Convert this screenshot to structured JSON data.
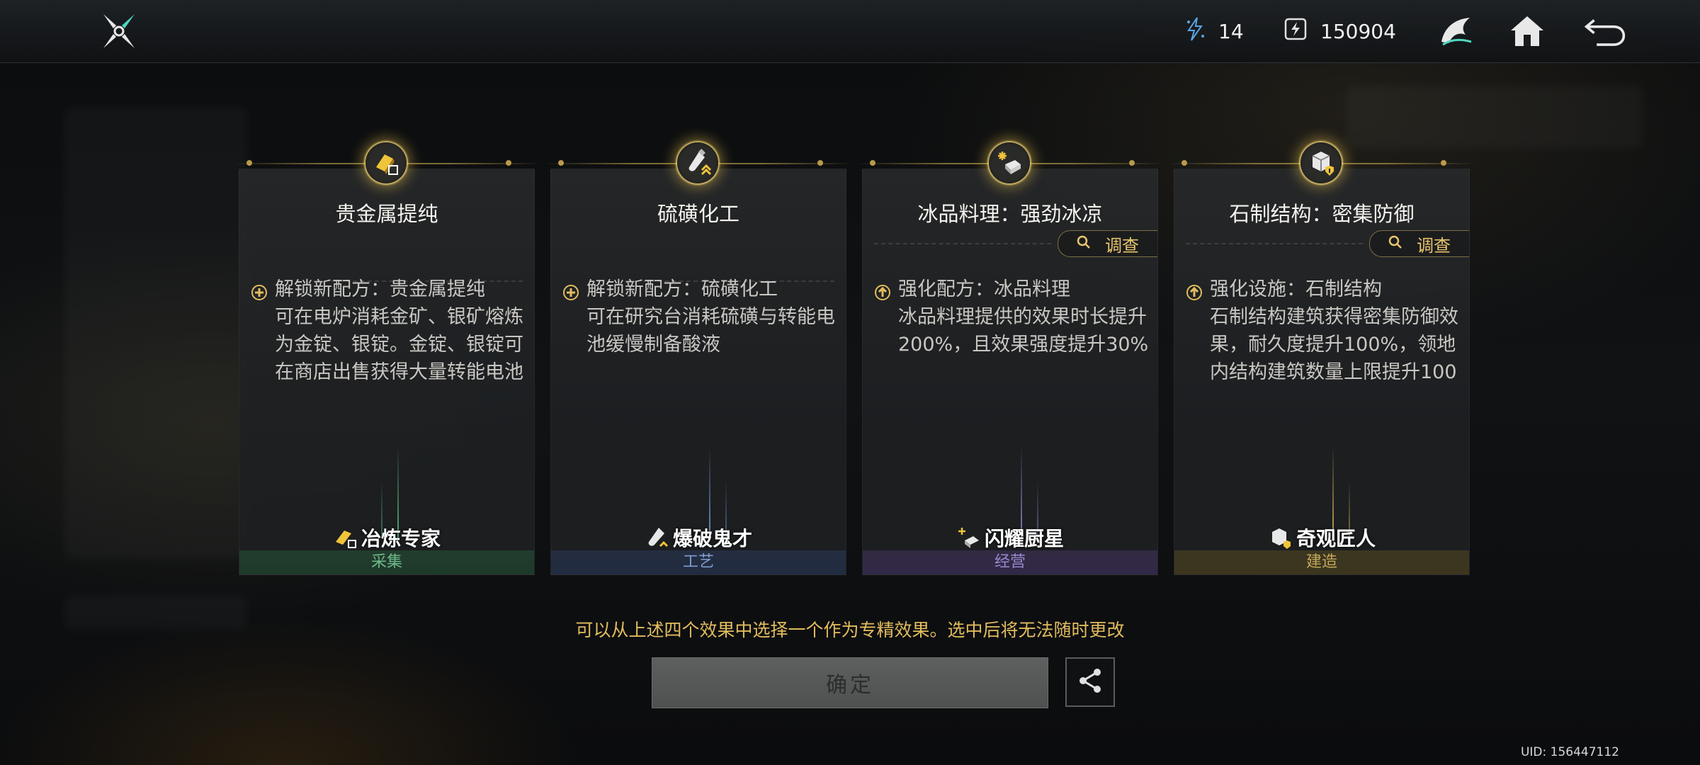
{
  "header": {
    "resource1_value": "14",
    "resource2_value": "150904",
    "icons": [
      "logo-icon",
      "energy-icon",
      "currency-icon",
      "emblem-icon",
      "home-icon",
      "back-icon"
    ]
  },
  "cards": [
    {
      "title": "贵金属提纯",
      "desc_head": "解锁新配方：贵金属提纯",
      "desc_body": "可在电炉消耗金矿、银矿熔炼为金锭、银锭。金锭、银锭可在商店出售获得大量转能电池",
      "desc_icon": "plus-circle-icon",
      "specialist": "冶炼专家",
      "category": "采集",
      "category_color": "#3f8a5c",
      "beam_color": "#5fcf8f"
    },
    {
      "title": "硫磺化工",
      "desc_head": "解锁新配方：硫磺化工",
      "desc_body": "可在研究台消耗硫磺与转能电池缓慢制备酸液",
      "desc_icon": "plus-circle-icon",
      "specialist": "爆破鬼才",
      "category": "工艺",
      "category_color": "#4a6fa8",
      "beam_color": "#7fa8e8"
    },
    {
      "title": "冰品料理：强劲冰凉",
      "investigate": "调查",
      "desc_head": "强化配方：冰品料理",
      "desc_body": "冰品料理提供的效果时长提升200%，且效果强度提升30%",
      "desc_icon": "up-arrow-circle-icon",
      "specialist": "闪耀厨星",
      "category": "经营",
      "category_color": "#7360a8",
      "beam_color": "#a890e8"
    },
    {
      "title": "石制结构：密集防御",
      "investigate": "调查",
      "desc_head": "强化设施：石制结构",
      "desc_body": "石制结构建筑获得密集防御效果，耐久度提升100%，领地内结构建筑数量上限提升100",
      "desc_icon": "up-arrow-circle-icon",
      "specialist": "奇观匠人",
      "category": "建造",
      "category_color": "#a8903a",
      "beam_color": "#e8c860"
    }
  ],
  "footer": {
    "hint": "可以从上述四个效果中选择一个作为专精效果。选中后将无法随时更改",
    "confirm_label": "确定",
    "uid": "UID: 156447112"
  },
  "colors": {
    "accent_gold": "#e2bd5e",
    "glow": "#f0c850"
  }
}
